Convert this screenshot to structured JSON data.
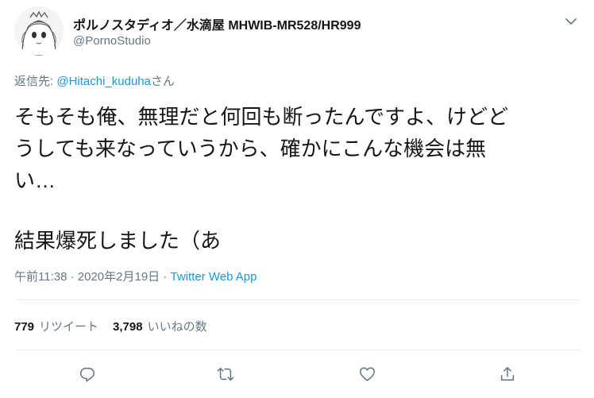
{
  "user": {
    "display_name": "ポルノスタディオ／水滴屋 MHWIB-MR528/HR999",
    "handle": "@PornoStudio"
  },
  "reply": {
    "prefix": "返信先: ",
    "mention": "@Hitachi_kuduha",
    "suffix": "さん"
  },
  "tweet": {
    "line1": "そもそも俺、無理だと何回も断ったんですよ、けどど",
    "line2": "うしても来なっていうから、確かにこんな機会は無",
    "line3": "い…",
    "line4": "結果爆死しました（あ"
  },
  "meta": {
    "time": "午前11:38",
    "sep1": " · ",
    "date": "2020年2月19日",
    "sep2": " · ",
    "source": "Twitter Web App"
  },
  "stats": {
    "retweets_count": "779",
    "retweets_label": "リツイート",
    "likes_count": "3,798",
    "likes_label": "いいねの数"
  },
  "icons": {
    "avatar": "user-avatar-illustration",
    "caret": "chevron-down-icon",
    "reply": "reply-icon",
    "retweet": "retweet-icon",
    "like": "heart-icon",
    "share": "share-icon"
  },
  "colors": {
    "link": "#1b95e0",
    "secondary_text": "#657786",
    "primary_text": "#14171a",
    "divider": "#e6ecf0"
  }
}
